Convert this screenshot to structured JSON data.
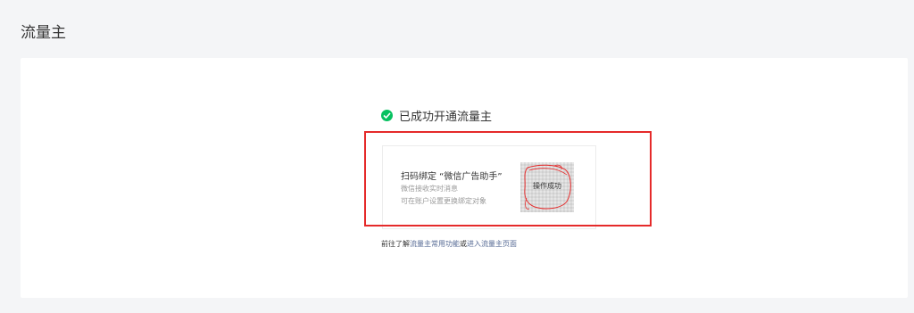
{
  "page": {
    "title": "流量主"
  },
  "status": {
    "text": "已成功开通流量主"
  },
  "bind_panel": {
    "title": "扫码绑定 “微信广告助手”",
    "line1": "微信接收实时消息",
    "line2": "可在账户设置更换绑定对象",
    "qr_label": "操作成功"
  },
  "footer": {
    "prefix": "前往了解",
    "link1": "流量主常用功能",
    "middle": "或",
    "link2": "进入流量主页面"
  },
  "colors": {
    "success": "#07c160",
    "highlight": "#e52a2a",
    "link": "#576b95"
  }
}
